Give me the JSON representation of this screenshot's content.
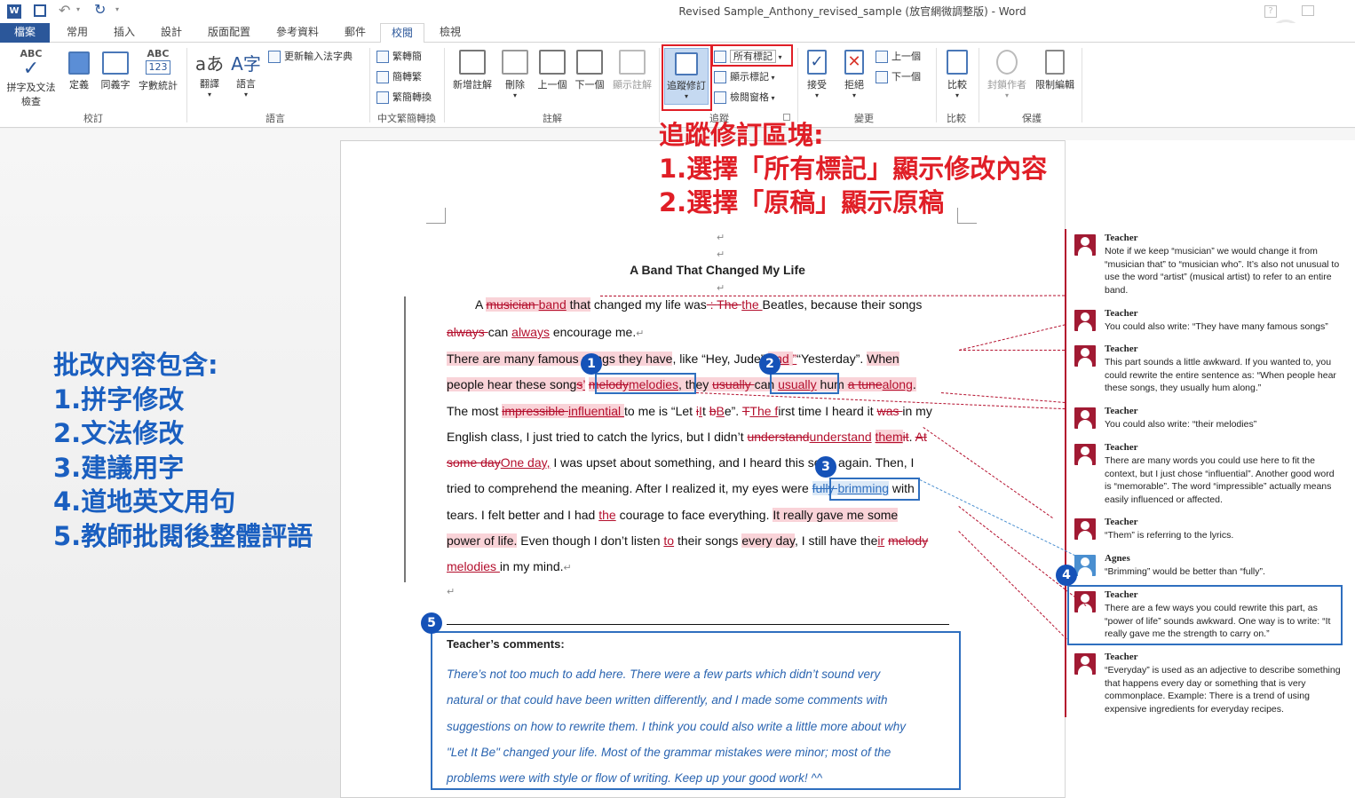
{
  "window": {
    "title": "Revised Sample_Anthony_revised_sample (放官網微調整版) - Word"
  },
  "tabs": [
    {
      "label": "檔案"
    },
    {
      "label": "常用"
    },
    {
      "label": "插入"
    },
    {
      "label": "設計"
    },
    {
      "label": "版面配置"
    },
    {
      "label": "參考資料"
    },
    {
      "label": "郵件"
    },
    {
      "label": "校閱"
    },
    {
      "label": "檢視"
    }
  ],
  "ribbon": {
    "proofing": {
      "spell_line1": "拼字及文法",
      "spell_line2": "檢查",
      "spell_icon": "ABC",
      "define": "定義",
      "thesaurus": "同義字",
      "wordcount": "字數統計",
      "wordcount_icon_top": "ABC",
      "wordcount_icon_bottom": "123",
      "group": "校訂"
    },
    "language": {
      "translate": "翻譯",
      "language": "語言",
      "update_ime": "更新輸入法字典",
      "group": "語言"
    },
    "chinese": {
      "t2s": "繁轉簡",
      "s2t": "簡轉繁",
      "convert": "繁簡轉換",
      "group": "中文繁簡轉換"
    },
    "comments": {
      "new": "新增註解",
      "delete": "刪除",
      "prev": "上一個",
      "next": "下一個",
      "show": "顯示註解",
      "group": "註解"
    },
    "tracking": {
      "track": "追蹤修訂",
      "all_markup": "所有標記",
      "show_markup": "顯示標記",
      "review_pane": "檢閱窗格",
      "group": "追蹤"
    },
    "changes": {
      "accept": "接受",
      "reject": "拒絕",
      "prev": "上一個",
      "next": "下一個",
      "group": "變更"
    },
    "compare": {
      "compare": "比較",
      "group": "比較"
    },
    "protect": {
      "block": "封鎖作者",
      "restrict": "限制編輯",
      "group": "保護"
    }
  },
  "annotations": {
    "tracking_note": [
      "追蹤修訂區塊:",
      "1.選擇「所有標記」顯示修改內容",
      "2.選擇「原稿」顯示原稿"
    ],
    "left_note": [
      "批改內容包含:",
      "1.拼字修改",
      "2.文法修改",
      "3.建議用字",
      "4.道地英文用句",
      "5.教師批閱後整體評語"
    ],
    "badges": [
      "1",
      "2",
      "3",
      "4",
      "5"
    ]
  },
  "document": {
    "title": "A Band That Changed My Life",
    "comments_heading": "Teacher’s comments:",
    "teacher_comments": [
      "There’s not too much to add here. There were a few parts which didn’t sound very",
      "natural or that could have been written differently, and I made some comments with",
      "suggestions on how to rewrite them. I think you could also write a little more about why",
      "\"Let It Be\" changed your life. Most of the grammar mistakes were minor; most of the",
      "problems were with style or flow of writing. Keep up your good work! ^^"
    ]
  },
  "comments": [
    {
      "author": "Teacher",
      "text": "Note if we keep “musician” we would change it from “musician that” to “musician who”. It’s also not unusual to use the word “artist” (musical artist) to refer to an entire band."
    },
    {
      "author": "Teacher",
      "text": "You could also write: “They have many famous songs”"
    },
    {
      "author": "Teacher",
      "text": "This part sounds a little awkward. If you wanted to, you could rewrite the entire sentence as: “When people hear these songs, they usually hum along.”"
    },
    {
      "author": "Teacher",
      "text": "You could also write: “their melodies”"
    },
    {
      "author": "Teacher",
      "text": "There are many words you could use here to fit the context, but I just chose “influential”. Another good word is “memorable”. The word “impressible” actually means easily influenced or affected."
    },
    {
      "author": "Teacher",
      "text": "“Them” is referring to the lyrics."
    },
    {
      "author": "Agnes",
      "text": "“Brimming” would be better than “fully”."
    },
    {
      "author": "Teacher",
      "text": "There are a few ways you could rewrite this part, as “power of life” sounds awkward. One way is to write: “It really gave me the strength to carry on.”"
    },
    {
      "author": "Teacher",
      "text": "“Everyday” is used as an adjective to describe something that happens every day or something that is very commonplace. Example: There is a trend of using expensive ingredients for everyday recipes."
    }
  ],
  "colors": {
    "accent": "#2b579a",
    "revision": "#b40f2d",
    "annotation_red": "#e01e26",
    "annotation_blue": "#1a5fc0"
  }
}
